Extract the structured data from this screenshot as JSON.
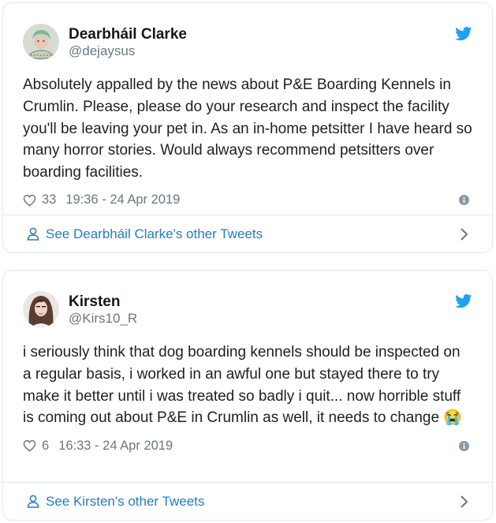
{
  "tweets": [
    {
      "author_name": "Dearbháil Clarke",
      "handle": "@dejaysus",
      "text": "Absolutely appalled by the news about P&E Boarding Kennels in Crumlin. Please, please do your research and inspect the facility you'll be leaving your pet in. As an in-home petsitter I have heard so many horror stories. Would always recommend petsitters over boarding facilities.",
      "emoji": "",
      "likes": "33",
      "timestamp": "19:36 - 24 Apr 2019",
      "see_other": "See Dearbháil Clarke's other Tweets",
      "avatar_icon": "avatar-green-hair-person"
    },
    {
      "author_name": "Kirsten",
      "handle": "@Kirs10_R",
      "text": "i seriously think that dog boarding kennels should be inspected on a regular basis, i worked in an awful one but stayed there to try make it better until i was treated so badly i quit... now horrible stuff is coming out about P&E in Crumlin as well, it needs to change ",
      "emoji": "😭",
      "likes": "6",
      "timestamp": "16:33 - 24 Apr 2019",
      "see_other": "See Kirsten's other Tweets",
      "avatar_icon": "avatar-woman-photo"
    }
  ],
  "colors": {
    "twitter_blue": "#1da1f2",
    "link_blue": "#2b7bb9",
    "meta_gray": "#697882",
    "border": "#e1e8ed"
  },
  "icons": [
    "twitter-bird-icon",
    "heart-icon",
    "info-icon",
    "person-icon",
    "chevron-right-icon"
  ]
}
